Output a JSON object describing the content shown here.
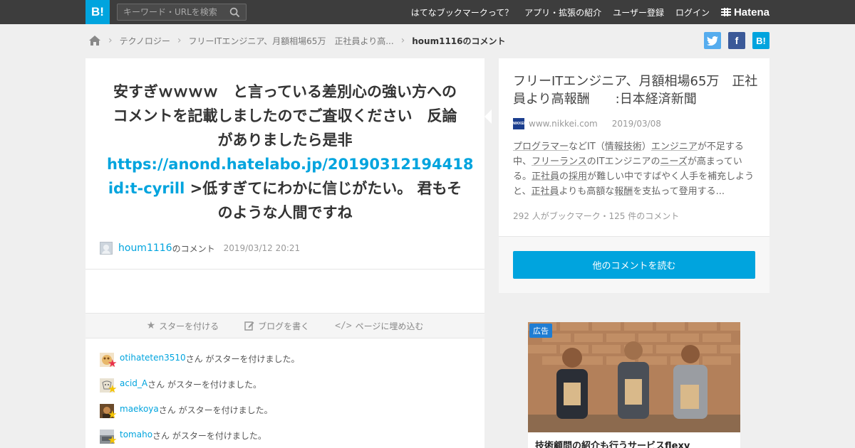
{
  "header": {
    "logo": "B!",
    "search_placeholder": "キーワード・URLを検索",
    "nav": [
      "はてなブックマークって？",
      "アプリ・拡張の紹介",
      "ユーザー登録",
      "ログイン"
    ],
    "brand": "Hatena"
  },
  "breadcrumb": {
    "items": [
      "テクノロジー",
      "フリーITエンジニア、月額相場65万　正社員より高..."
    ],
    "current": "houm1116のコメント"
  },
  "share": {
    "twitter": "t",
    "facebook": "f",
    "hatebu": "B!"
  },
  "comment": {
    "text_before": "安すぎｗｗｗｗ　と言っている差別心の強い方へのコメントを記載しましたのでご査収ください　反論がありましたら是非 ",
    "link": "https://anond.hatelabo.jp/20190312194418",
    "text_mid": " ",
    "id_link": "id:t-cyrill",
    "text_after": " >低すぎてにわかに信じがたい。 君もそのような人間ですね",
    "user": "houm1116",
    "user_suffix": "のコメント",
    "date": "2019/03/12 20:21"
  },
  "actions": [
    "スターを付ける",
    "ブログを書く",
    "ページに埋め込む"
  ],
  "stars": [
    {
      "user": "otihateten3510",
      "suffix": "さん がスターを付けました。",
      "star_color": "#e8304a"
    },
    {
      "user": "acid_A",
      "suffix": "さん がスターを付けました。",
      "star_color": "#f5c400"
    },
    {
      "user": "maekoya",
      "suffix": "さん がスターを付けました。",
      "star_color": "#f5c400"
    },
    {
      "user": "tomaho",
      "suffix": "さん がスターを付けました。",
      "star_color": "#f5c400"
    }
  ],
  "entry": {
    "title": "フリーITエンジニア、月額相場65万　正社員より高報酬　　:日本経済新聞",
    "favicon_text": "NIKKEI",
    "domain": "www.nikkei.com",
    "date": "2019/03/08",
    "desc_parts": [
      [
        "プログラマー",
        true
      ],
      [
        "などIT（",
        false
      ],
      [
        "情報技術",
        true
      ],
      [
        "）",
        false
      ],
      [
        "エンジニア",
        true
      ],
      [
        "が不足する中、",
        false
      ],
      [
        "フリーランス",
        true
      ],
      [
        "のITエンジニアの",
        false
      ],
      [
        "ニーズ",
        true
      ],
      [
        "が高まっている。",
        false
      ],
      [
        "正社員",
        true
      ],
      [
        "の",
        false
      ],
      [
        "採用",
        true
      ],
      [
        "が難しい中ですばやく人手を補充しようと、",
        false
      ],
      [
        "正社員",
        true
      ],
      [
        "よりも高額な",
        false
      ],
      [
        "報酬",
        true
      ],
      [
        "を支払って登用する...",
        false
      ]
    ],
    "stats": "292 人がブックマーク・125 件のコメント",
    "read_more": "他のコメントを読む"
  },
  "ad": {
    "label": "広告",
    "title": "技術顧問の紹介も行うサービスflexy"
  },
  "colors": {
    "accent": "#00a4de",
    "topbar": "#3d3d3d",
    "background": "#efefef"
  }
}
